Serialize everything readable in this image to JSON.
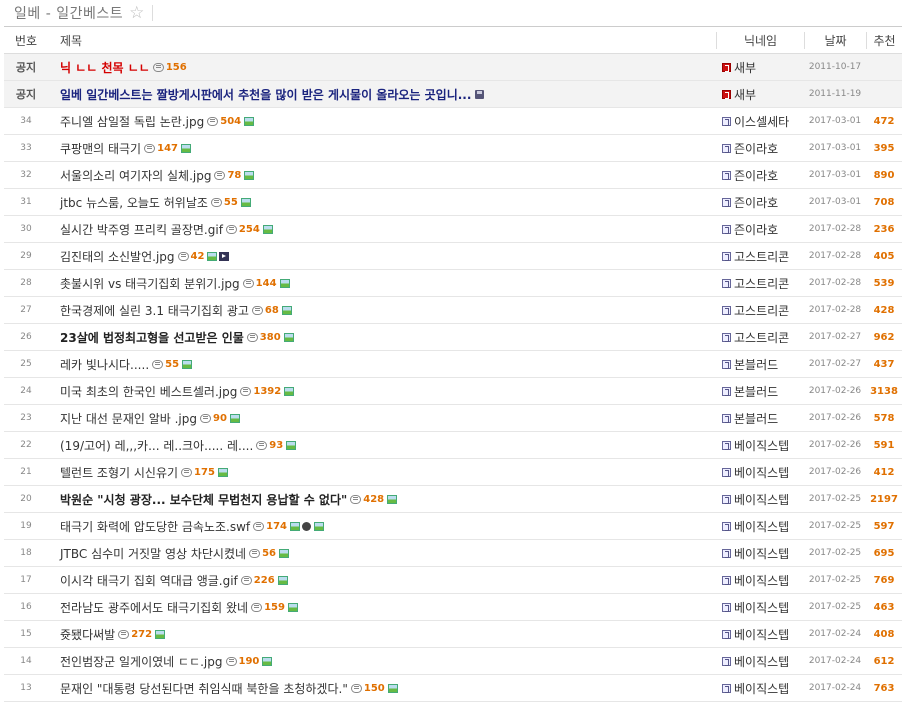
{
  "header": {
    "title": "일베 - 일간베스트",
    "star": "☆"
  },
  "columns": {
    "no": "번호",
    "title": "제목",
    "nick": "닉네임",
    "date": "날짜",
    "vote": "추천"
  },
  "rows": [
    {
      "no": "공지",
      "title": "닉 ㄴㄴ 천목 ㄴㄴ",
      "comments": "156",
      "nick": "새부",
      "date": "2011-10-17",
      "vote": ""
    },
    {
      "no": "공지",
      "title": "일베 일간베스트는 짤방게시판에서 추천을 많이 받은 게시물이 올라오는 곳입니...",
      "comments": "",
      "nick": "새부",
      "date": "2011-11-19",
      "vote": ""
    },
    {
      "no": "34",
      "title": "주니엘 삼일절 독립 논란.jpg",
      "comments": "504",
      "nick": "이스셀세타",
      "date": "2017-03-01",
      "vote": "472"
    },
    {
      "no": "33",
      "title": "쿠팡맨의 태극기",
      "comments": "147",
      "nick": "즌이라호",
      "date": "2017-03-01",
      "vote": "395"
    },
    {
      "no": "32",
      "title": "서울의소리 여기자의 실체.jpg",
      "comments": "78",
      "nick": "즌이라호",
      "date": "2017-03-01",
      "vote": "890"
    },
    {
      "no": "31",
      "title": "jtbc 뉴스룸, 오늘도 허위날조",
      "comments": "55",
      "nick": "즌이라호",
      "date": "2017-03-01",
      "vote": "708"
    },
    {
      "no": "30",
      "title": "실시간 박주영 프리킥 골장면.gif",
      "comments": "254",
      "nick": "즌이라호",
      "date": "2017-02-28",
      "vote": "236"
    },
    {
      "no": "29",
      "title": "김진태의 소신발언.jpg",
      "comments": "42",
      "nick": "고스트리콘",
      "date": "2017-02-28",
      "vote": "405"
    },
    {
      "no": "28",
      "title": "촛불시위 vs 태극기집회 분위기.jpg",
      "comments": "144",
      "nick": "고스트리콘",
      "date": "2017-02-28",
      "vote": "539"
    },
    {
      "no": "27",
      "title": "한국경제에 실린 3.1 태극기집회 광고",
      "comments": "68",
      "nick": "고스트리콘",
      "date": "2017-02-28",
      "vote": "428"
    },
    {
      "no": "26",
      "title": "23살에 법정최고형을 선고받은 인물",
      "comments": "380",
      "nick": "고스트리콘",
      "date": "2017-02-27",
      "vote": "962"
    },
    {
      "no": "25",
      "title": "레카 빛나시다.....",
      "comments": "55",
      "nick": "본블러드",
      "date": "2017-02-27",
      "vote": "437"
    },
    {
      "no": "24",
      "title": "미국 최초의 한국인 베스트셀러.jpg",
      "comments": "1392",
      "nick": "본블러드",
      "date": "2017-02-26",
      "vote": "3138"
    },
    {
      "no": "23",
      "title": "지난 대선 문재인 알바 .jpg",
      "comments": "90",
      "nick": "본블러드",
      "date": "2017-02-26",
      "vote": "578"
    },
    {
      "no": "22",
      "title": "(19/고어) 레,,,카... 레..크아..... 레....",
      "comments": "93",
      "nick": "베이직스텝",
      "date": "2017-02-26",
      "vote": "591"
    },
    {
      "no": "21",
      "title": "텔런트 조형기 시신유기",
      "comments": "175",
      "nick": "베이직스텝",
      "date": "2017-02-26",
      "vote": "412"
    },
    {
      "no": "20",
      "title": "박원순 \"시청 광장... 보수단체 무법천지 용납할 수 없다\"",
      "comments": "428",
      "nick": "베이직스텝",
      "date": "2017-02-25",
      "vote": "2197"
    },
    {
      "no": "19",
      "title": "태극기 화력에 압도당한 금속노조.swf",
      "comments": "174",
      "nick": "베이직스텝",
      "date": "2017-02-25",
      "vote": "597"
    },
    {
      "no": "18",
      "title": "JTBC 심수미 거짓말 영상 차단시켰네",
      "comments": "56",
      "nick": "베이직스텝",
      "date": "2017-02-25",
      "vote": "695"
    },
    {
      "no": "17",
      "title": "이시각 태극기 집회 역대급 앵글.gif",
      "comments": "226",
      "nick": "베이직스텝",
      "date": "2017-02-25",
      "vote": "769"
    },
    {
      "no": "16",
      "title": "전라남도 광주에서도 태극기집회 왔네",
      "comments": "159",
      "nick": "베이직스텝",
      "date": "2017-02-25",
      "vote": "463"
    },
    {
      "no": "15",
      "title": "쥿됐다써발",
      "comments": "272",
      "nick": "베이직스텝",
      "date": "2017-02-24",
      "vote": "408"
    },
    {
      "no": "14",
      "title": "전인범장군 일게이였네 ㄷㄷ.jpg",
      "comments": "190",
      "nick": "베이직스텝",
      "date": "2017-02-24",
      "vote": "612"
    },
    {
      "no": "13",
      "title": "문재인 \"대통령 당선된다면 취임식때 북한을 초청하겠다.\"",
      "comments": "150",
      "nick": "베이직스텝",
      "date": "2017-02-24",
      "vote": "763"
    }
  ]
}
